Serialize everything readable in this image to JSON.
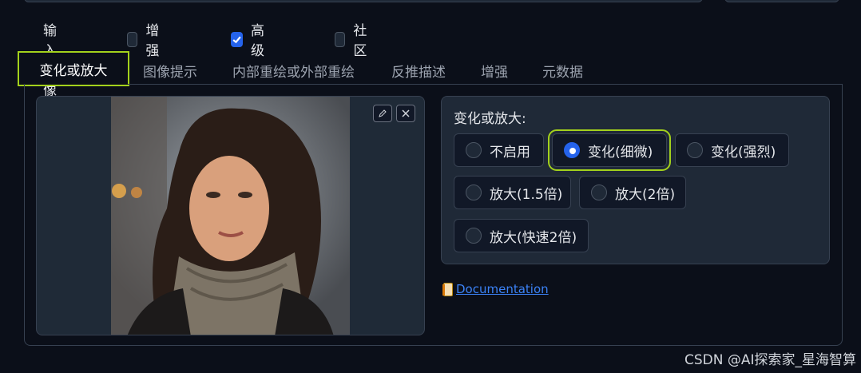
{
  "checkboxes": [
    {
      "label": "输入图像",
      "checked": true
    },
    {
      "label": "增强",
      "checked": false
    },
    {
      "label": "高级",
      "checked": true
    },
    {
      "label": "社区",
      "checked": false
    }
  ],
  "tabs": [
    "变化或放大",
    "图像提示",
    "内部重绘或外部重绘",
    "反推描述",
    "增强",
    "元数据"
  ],
  "active_tab": "变化或放大",
  "image_tools": {
    "edit_icon": "pencil-icon",
    "close_icon": "close-icon"
  },
  "radio_group": {
    "title": "变化或放大:",
    "options": [
      "不启用",
      "变化(细微)",
      "变化(强烈)",
      "放大(1.5倍)",
      "放大(2倍)",
      "放大(快速2倍)"
    ],
    "selected": "变化(细微)"
  },
  "documentation": {
    "label": "Documentation",
    "icon": "book-icon"
  },
  "watermark": "CSDN @AI探索家_星海智算",
  "colors": {
    "accent": "#2563eb",
    "highlight": "#a3d11c",
    "background": "#0b0f19",
    "link": "#3b82f6"
  }
}
